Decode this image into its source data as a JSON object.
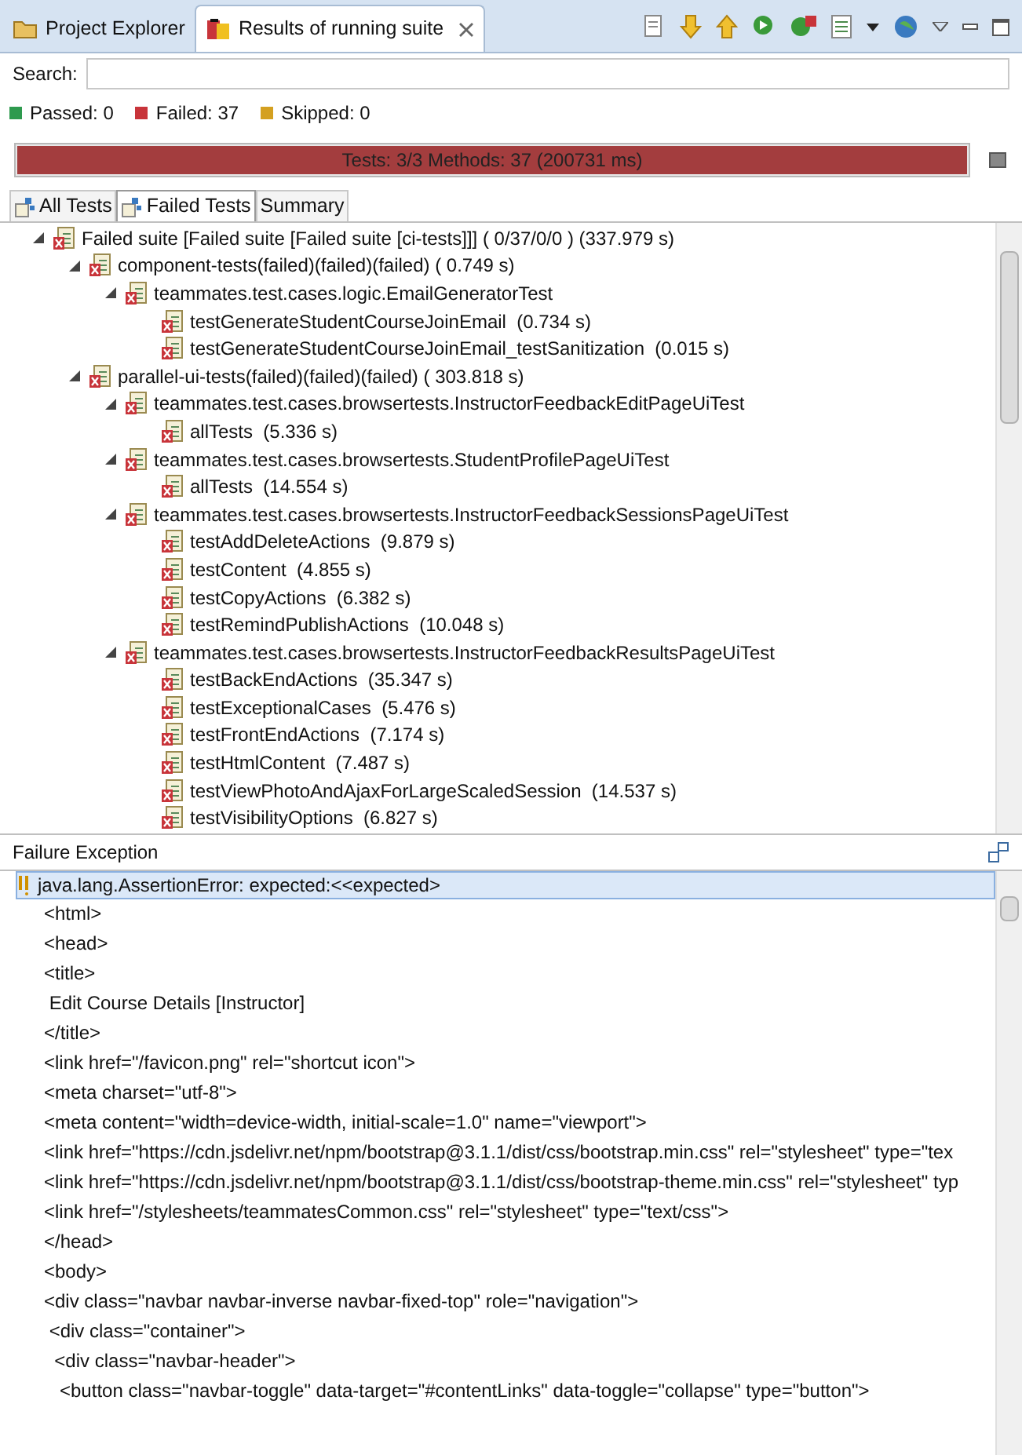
{
  "view_tabs": [
    {
      "label": "Project Explorer",
      "selected": false,
      "closable": false
    },
    {
      "label": "Results of running suite",
      "selected": true,
      "closable": true
    }
  ],
  "search": {
    "label": "Search:"
  },
  "counters": [
    {
      "label": "Passed: 0",
      "color": "#2e9a4e"
    },
    {
      "label": "Failed: 37",
      "color": "#c8343a"
    },
    {
      "label": "Skipped: 0",
      "color": "#d4a020"
    }
  ],
  "progress": {
    "text": "Tests: 3/3  Methods: 37 (200731 ms)",
    "level": 1
  },
  "result_tabs": [
    {
      "label": "All Tests",
      "selected": false,
      "icon": true
    },
    {
      "label": "Failed Tests",
      "selected": true,
      "icon": true
    },
    {
      "label": "Summary",
      "selected": false,
      "icon": false
    }
  ],
  "tree": [
    {
      "label": "Failed suite [Failed suite [Failed suite [ci-tests]]] ( 0/37/0/0 ) (337.979 s)",
      "expanded": true,
      "children": [
        {
          "label": "component-tests(failed)(failed)(failed) ( 0.749 s)",
          "expanded": true,
          "children": [
            {
              "label": "teammates.test.cases.logic.EmailGeneratorTest",
              "expanded": true,
              "children": [
                {
                  "label": "testGenerateStudentCourseJoinEmail  (0.734 s)"
                },
                {
                  "label": "testGenerateStudentCourseJoinEmail_testSanitization  (0.015 s)"
                }
              ]
            }
          ]
        },
        {
          "label": "parallel-ui-tests(failed)(failed)(failed) ( 303.818 s)",
          "expanded": true,
          "children": [
            {
              "label": "teammates.test.cases.browsertests.InstructorFeedbackEditPageUiTest",
              "expanded": true,
              "children": [
                {
                  "label": "allTests  (5.336 s)"
                }
              ]
            },
            {
              "label": "teammates.test.cases.browsertests.StudentProfilePageUiTest",
              "expanded": true,
              "children": [
                {
                  "label": "allTests  (14.554 s)"
                }
              ]
            },
            {
              "label": "teammates.test.cases.browsertests.InstructorFeedbackSessionsPageUiTest",
              "expanded": true,
              "children": [
                {
                  "label": "testAddDeleteActions  (9.879 s)"
                },
                {
                  "label": "testContent  (4.855 s)"
                },
                {
                  "label": "testCopyActions  (6.382 s)"
                },
                {
                  "label": "testRemindPublishActions  (10.048 s)"
                }
              ]
            },
            {
              "label": "teammates.test.cases.browsertests.InstructorFeedbackResultsPageUiTest",
              "expanded": true,
              "children": [
                {
                  "label": "testBackEndActions  (35.347 s)"
                },
                {
                  "label": "testExceptionalCases  (5.476 s)"
                },
                {
                  "label": "testFrontEndActions  (7.174 s)"
                },
                {
                  "label": "testHtmlContent  (7.487 s)"
                },
                {
                  "label": "testViewPhotoAndAjaxForLargeScaledSession  (14.537 s)"
                },
                {
                  "label": "testVisibilityOptions  (6.827 s)"
                }
              ]
            }
          ]
        }
      ]
    }
  ],
  "failure": {
    "title": "Failure Exception",
    "header": "java.lang.AssertionError: expected:<<expected>",
    "lines": [
      "<html>",
      "<head>",
      "<title>",
      " Edit Course Details [Instructor]",
      "</title>",
      "<link href=\"/favicon.png\" rel=\"shortcut icon\">",
      "<meta charset=\"utf-8\">",
      "<meta content=\"width=device-width, initial-scale=1.0\" name=\"viewport\">",
      "<link href=\"https://cdn.jsdelivr.net/npm/bootstrap@3.1.1/dist/css/bootstrap.min.css\" rel=\"stylesheet\" type=\"tex",
      "<link href=\"https://cdn.jsdelivr.net/npm/bootstrap@3.1.1/dist/css/bootstrap-theme.min.css\" rel=\"stylesheet\" typ",
      "<link href=\"/stylesheets/teammatesCommon.css\" rel=\"stylesheet\" type=\"text/css\">",
      "</head>",
      "<body>",
      "<div class=\"navbar navbar-inverse navbar-fixed-top\" role=\"navigation\">",
      " <div class=\"container\">",
      "  <div class=\"navbar-header\">",
      "   <button class=\"navbar-toggle\" data-target=\"#contentLinks\" data-toggle=\"collapse\" type=\"button\">"
    ]
  }
}
